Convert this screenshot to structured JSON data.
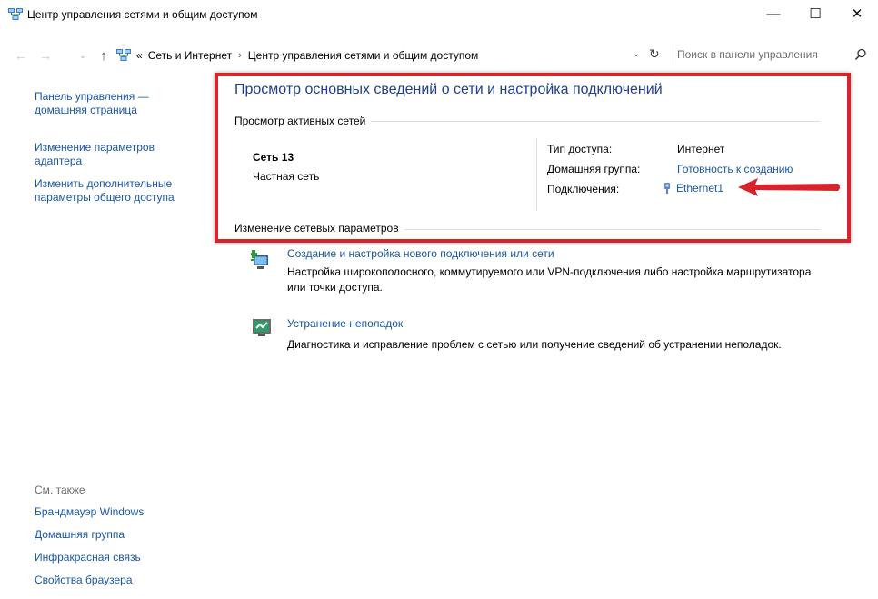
{
  "window": {
    "title": "Центр управления сетями и общим доступом",
    "minimize_glyph": "—",
    "maximize_glyph": "☐",
    "close_glyph": "✕"
  },
  "addressbar": {
    "back_glyph": "←",
    "forward_glyph": "→",
    "recent_glyph": "⌄",
    "up_glyph": "↑",
    "overflow": "«",
    "crumbs": [
      "Сеть и Интернет",
      "Центр управления сетями и общим доступом"
    ],
    "separator": "›",
    "dropdown_glyph": "⌄",
    "refresh_glyph": "↻",
    "search_placeholder": "Поиск в панели управления"
  },
  "sidebar": {
    "home_link": "Панель управления — домашняя страница",
    "adapter_link": "Изменение параметров адаптера",
    "sharing_link": "Изменить дополнительные параметры общего доступа",
    "see_also_title": "См. также",
    "see_also": [
      "Брандмауэр Windows",
      "Домашняя группа",
      "Инфракрасная связь",
      "Свойства браузера"
    ]
  },
  "main": {
    "title": "Просмотр основных сведений о сети и настройка подключений",
    "active_networks_label": "Просмотр активных сетей",
    "network": {
      "name": "Сеть  13",
      "type": "Частная сеть",
      "access_label": "Тип доступа:",
      "access_value": "Интернет",
      "homegroup_label": "Домашняя группа:",
      "homegroup_value": "Готовность к созданию",
      "connections_label": "Подключения:",
      "connections_value": "Ethernet1"
    },
    "change_settings_label": "Изменение сетевых параметров",
    "tasks": [
      {
        "title": "Создание и настройка нового подключения или сети",
        "description": "Настройка широкополосного, коммутируемого или VPN-подключения либо настройка маршрутизатора или точки доступа."
      },
      {
        "title": "Устранение неполадок",
        "description": "Диагностика и исправление проблем с сетью или получение сведений об устранении неполадок."
      }
    ]
  },
  "colors": {
    "link": "#1a57a6",
    "title": "#1e3f8a",
    "highlight": "#d9232a"
  }
}
